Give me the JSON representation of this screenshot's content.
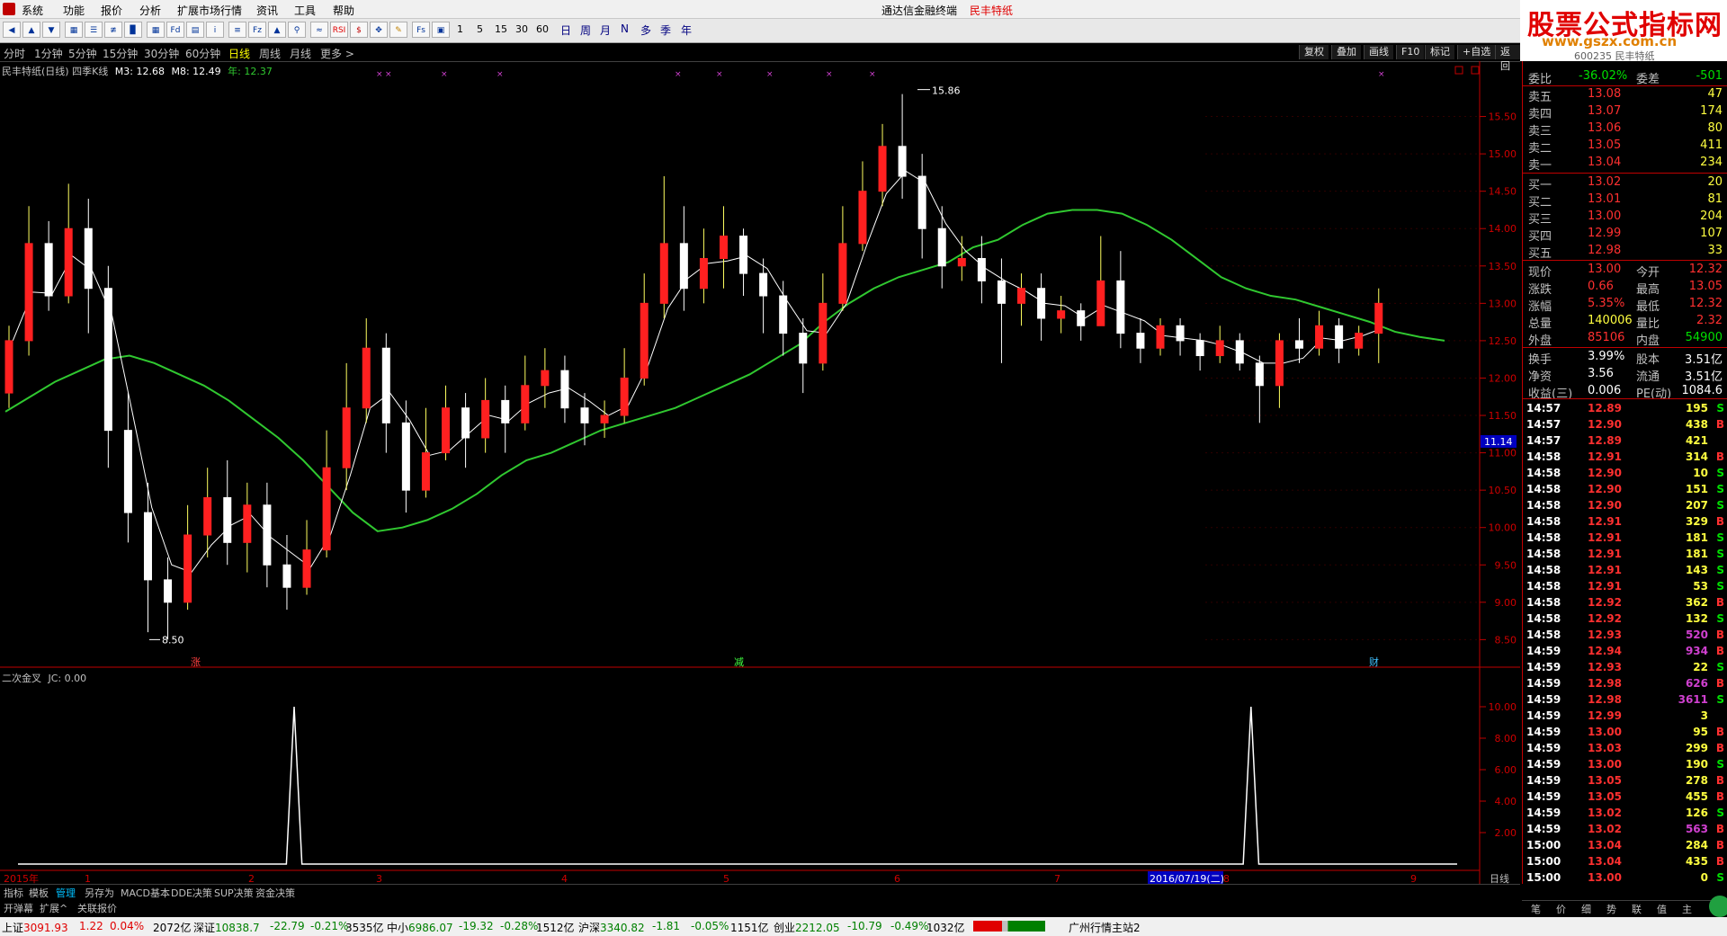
{
  "menu": {
    "items": [
      "系统",
      "功能",
      "报价",
      "分析",
      "扩展市场行情",
      "资讯",
      "工具",
      "帮助"
    ],
    "app_name": "通达信金融终端",
    "stock_title": "民丰特纸"
  },
  "watermark": {
    "line1": "股票公式指标网",
    "line2": "www.gszx.com.cn",
    "sub": "600235 民丰特纸"
  },
  "toolbar": {
    "periods": [
      "1",
      "5",
      "15",
      "30",
      "60"
    ],
    "cn_periods": [
      "日",
      "周",
      "月",
      "N",
      "多",
      "季",
      "年"
    ]
  },
  "periodbar": {
    "items": [
      "分时",
      "1分钟",
      "5分钟",
      "15分钟",
      "30分钟",
      "60分钟",
      "日线",
      "周线",
      "月线",
      "更多 >"
    ],
    "active": "日线",
    "right_buttons": [
      "复权",
      "叠加",
      "画线",
      "F10",
      "标记",
      "+自选",
      "返回"
    ]
  },
  "chart_header": {
    "name": "民丰特纸(日线) 四季K线",
    "m3": "M3: 12.68",
    "m8": "M8: 12.49",
    "year": "年: 12.37"
  },
  "indicator_header": {
    "name": "二次金叉",
    "jc": "JC: 0.00"
  },
  "chart_data": [
    {
      "type": "candlestick",
      "title": "民丰特纸(日线) 四季K线",
      "yticks": [
        "15.50",
        "15.00",
        "14.50",
        "14.00",
        "13.50",
        "13.00",
        "12.50",
        "12.00",
        "11.50",
        "11.00",
        "10.50",
        "10.00",
        "9.50",
        "9.00",
        "8.50"
      ],
      "ylim": [
        8.3,
        16.0
      ],
      "max_label": "15.86",
      "min_label": "8.50",
      "current_price_tag": "11.14",
      "event_markers": [
        "涨",
        "减",
        "财"
      ],
      "xticks": [
        "2015年",
        "1",
        "2",
        "3",
        "4",
        "5",
        "6",
        "7",
        "2016/07/19(二)",
        "8",
        "9"
      ],
      "period_label": "日线",
      "series": [
        {
          "name": "M3",
          "color": "#ffffff"
        },
        {
          "name": "M8",
          "color": "#ffffff"
        },
        {
          "name": "年",
          "color": "#30c830"
        }
      ],
      "ma_year": [
        [
          0,
          11.55
        ],
        [
          10,
          11.75
        ],
        [
          20,
          11.95
        ],
        [
          30,
          12.1
        ],
        [
          40,
          12.25
        ],
        [
          50,
          12.3
        ],
        [
          60,
          12.2
        ],
        [
          70,
          12.05
        ],
        [
          80,
          11.9
        ],
        [
          90,
          11.7
        ],
        [
          100,
          11.45
        ],
        [
          110,
          11.2
        ],
        [
          120,
          10.9
        ],
        [
          130,
          10.55
        ],
        [
          140,
          10.2
        ],
        [
          150,
          9.95
        ],
        [
          160,
          10.0
        ],
        [
          170,
          10.1
        ],
        [
          180,
          10.25
        ],
        [
          190,
          10.45
        ],
        [
          200,
          10.7
        ],
        [
          210,
          10.9
        ],
        [
          220,
          11.0
        ],
        [
          230,
          11.15
        ],
        [
          240,
          11.3
        ],
        [
          250,
          11.4
        ],
        [
          260,
          11.5
        ],
        [
          270,
          11.6
        ],
        [
          280,
          11.75
        ],
        [
          290,
          11.9
        ],
        [
          300,
          12.05
        ],
        [
          310,
          12.25
        ],
        [
          320,
          12.45
        ],
        [
          330,
          12.75
        ],
        [
          340,
          13.0
        ],
        [
          350,
          13.2
        ],
        [
          360,
          13.35
        ],
        [
          370,
          13.45
        ],
        [
          380,
          13.55
        ],
        [
          390,
          13.75
        ],
        [
          400,
          13.85
        ],
        [
          410,
          14.05
        ],
        [
          420,
          14.2
        ],
        [
          430,
          14.25
        ],
        [
          440,
          14.25
        ],
        [
          450,
          14.2
        ],
        [
          460,
          14.05
        ],
        [
          470,
          13.85
        ],
        [
          480,
          13.6
        ],
        [
          490,
          13.35
        ],
        [
          500,
          13.2
        ],
        [
          510,
          13.1
        ],
        [
          520,
          13.05
        ],
        [
          530,
          12.95
        ],
        [
          540,
          12.85
        ],
        [
          550,
          12.75
        ],
        [
          560,
          12.62
        ],
        [
          570,
          12.55
        ],
        [
          580,
          12.5
        ]
      ],
      "candles": [
        [
          0,
          11.8,
          12.5,
          12.7,
          11.6
        ],
        [
          8,
          12.5,
          13.8,
          14.3,
          12.3
        ],
        [
          16,
          13.8,
          13.1,
          14.1,
          12.9
        ],
        [
          24,
          13.1,
          14.0,
          14.6,
          13.0
        ],
        [
          32,
          14.0,
          13.2,
          14.4,
          12.6
        ],
        [
          40,
          13.2,
          11.3,
          13.5,
          10.8
        ],
        [
          48,
          11.3,
          10.2,
          11.8,
          9.8
        ],
        [
          56,
          10.2,
          9.3,
          10.6,
          8.6
        ],
        [
          64,
          9.3,
          9.0,
          9.6,
          8.5
        ],
        [
          72,
          9.0,
          9.9,
          10.3,
          8.9
        ],
        [
          80,
          9.9,
          10.4,
          10.8,
          9.6
        ],
        [
          88,
          10.4,
          9.8,
          10.9,
          9.5
        ],
        [
          96,
          9.8,
          10.3,
          10.6,
          9.4
        ],
        [
          104,
          10.3,
          9.5,
          10.6,
          9.2
        ],
        [
          112,
          9.5,
          9.2,
          9.9,
          8.9
        ],
        [
          120,
          9.2,
          9.7,
          10.1,
          9.1
        ],
        [
          128,
          9.7,
          10.8,
          11.3,
          9.6
        ],
        [
          136,
          10.8,
          11.6,
          12.2,
          10.5
        ],
        [
          144,
          11.6,
          12.4,
          12.8,
          11.4
        ],
        [
          152,
          12.4,
          11.4,
          12.6,
          11.0
        ],
        [
          160,
          11.4,
          10.5,
          11.7,
          10.2
        ],
        [
          168,
          10.5,
          11.0,
          11.6,
          10.4
        ],
        [
          176,
          11.0,
          11.6,
          11.9,
          10.9
        ],
        [
          184,
          11.6,
          11.2,
          11.8,
          10.8
        ],
        [
          192,
          11.2,
          11.7,
          12.0,
          11.0
        ],
        [
          200,
          11.7,
          11.4,
          11.9,
          11.0
        ],
        [
          208,
          11.4,
          11.9,
          12.3,
          11.3
        ],
        [
          216,
          11.9,
          12.1,
          12.4,
          11.6
        ],
        [
          224,
          12.1,
          11.6,
          12.3,
          11.4
        ],
        [
          232,
          11.6,
          11.4,
          11.8,
          11.1
        ],
        [
          240,
          11.4,
          11.5,
          11.7,
          11.2
        ],
        [
          248,
          11.5,
          12.0,
          12.4,
          11.4
        ],
        [
          256,
          12.0,
          13.0,
          13.4,
          11.9
        ],
        [
          264,
          13.0,
          13.8,
          14.7,
          12.8
        ],
        [
          272,
          13.8,
          13.2,
          14.3,
          12.9
        ],
        [
          280,
          13.2,
          13.6,
          14.0,
          13.0
        ],
        [
          288,
          13.6,
          13.9,
          14.3,
          13.2
        ],
        [
          296,
          13.9,
          13.4,
          14.0,
          13.1
        ],
        [
          304,
          13.4,
          13.1,
          13.6,
          12.6
        ],
        [
          312,
          13.1,
          12.6,
          13.3,
          12.3
        ],
        [
          320,
          12.6,
          12.2,
          12.8,
          11.8
        ],
        [
          328,
          12.2,
          13.0,
          13.4,
          12.1
        ],
        [
          336,
          13.0,
          13.8,
          14.3,
          12.9
        ],
        [
          344,
          13.8,
          14.5,
          14.9,
          13.7
        ],
        [
          352,
          14.5,
          15.1,
          15.4,
          14.3
        ],
        [
          360,
          15.1,
          14.7,
          15.8,
          14.4
        ],
        [
          368,
          14.7,
          14.0,
          15.0,
          13.6
        ],
        [
          376,
          14.0,
          13.5,
          14.3,
          13.2
        ],
        [
          384,
          13.5,
          13.6,
          13.9,
          13.3
        ],
        [
          392,
          13.6,
          13.3,
          13.9,
          13.0
        ],
        [
          400,
          13.3,
          13.0,
          13.6,
          12.2
        ],
        [
          408,
          13.0,
          13.2,
          13.4,
          12.7
        ],
        [
          416,
          13.2,
          12.8,
          13.4,
          12.5
        ],
        [
          424,
          12.8,
          12.9,
          13.1,
          12.6
        ],
        [
          432,
          12.9,
          12.7,
          13.0,
          12.5
        ],
        [
          440,
          12.7,
          13.3,
          13.9,
          12.7
        ],
        [
          448,
          13.3,
          12.6,
          13.7,
          12.4
        ],
        [
          456,
          12.6,
          12.4,
          12.8,
          12.2
        ],
        [
          464,
          12.4,
          12.7,
          12.8,
          12.3
        ],
        [
          472,
          12.7,
          12.5,
          12.8,
          12.3
        ],
        [
          480,
          12.5,
          12.3,
          12.6,
          12.1
        ],
        [
          488,
          12.3,
          12.5,
          12.7,
          12.2
        ],
        [
          496,
          12.5,
          12.2,
          12.6,
          12.1
        ],
        [
          504,
          12.2,
          11.9,
          12.3,
          11.4
        ],
        [
          512,
          11.9,
          12.5,
          12.6,
          11.6
        ],
        [
          520,
          12.5,
          12.4,
          12.8,
          12.2
        ],
        [
          528,
          12.4,
          12.7,
          12.9,
          12.3
        ],
        [
          536,
          12.7,
          12.4,
          12.8,
          12.2
        ],
        [
          544,
          12.4,
          12.6,
          12.7,
          12.3
        ],
        [
          552,
          12.6,
          13.0,
          13.2,
          12.2
        ]
      ]
    },
    {
      "type": "line",
      "title": "二次金叉",
      "yticks": [
        "10.00",
        "8.00",
        "6.00",
        "4.00",
        "2.00"
      ],
      "ylim": [
        0,
        11.2
      ],
      "x": [
        0,
        138,
        142,
        146,
        630,
        634,
        638,
        740
      ],
      "values": [
        0,
        0,
        10,
        0,
        0,
        10,
        0,
        0
      ]
    }
  ],
  "quote": {
    "webi": {
      "label": "委比",
      "value": "-36.02%",
      "label2": "委差",
      "value2": "-501"
    },
    "asks": [
      {
        "label": "卖五",
        "price": "13.08",
        "vol": "47"
      },
      {
        "label": "卖四",
        "price": "13.07",
        "vol": "174"
      },
      {
        "label": "卖三",
        "price": "13.06",
        "vol": "80"
      },
      {
        "label": "卖二",
        "price": "13.05",
        "vol": "411"
      },
      {
        "label": "卖一",
        "price": "13.04",
        "vol": "234"
      }
    ],
    "bids": [
      {
        "label": "买一",
        "price": "13.02",
        "vol": "20"
      },
      {
        "label": "买二",
        "price": "13.01",
        "vol": "81"
      },
      {
        "label": "买三",
        "price": "13.00",
        "vol": "204"
      },
      {
        "label": "买四",
        "price": "12.99",
        "vol": "107"
      },
      {
        "label": "买五",
        "price": "12.98",
        "vol": "33"
      }
    ],
    "stats": [
      {
        "l1": "现价",
        "v1": "13.00",
        "l2": "今开",
        "v2": "12.32"
      },
      {
        "l1": "涨跌",
        "v1": "0.66",
        "l2": "最高",
        "v2": "13.05"
      },
      {
        "l1": "涨幅",
        "v1": "5.35%",
        "l2": "最低",
        "v2": "12.32"
      },
      {
        "l1": "总量",
        "v1": "140006",
        "l2": "量比",
        "v2": "2.32"
      },
      {
        "l1": "外盘",
        "v1": "85106",
        "l2": "内盘",
        "v2": "54900"
      }
    ],
    "stats2": [
      {
        "l1": "换手",
        "v1": "3.99%",
        "l2": "股本",
        "v2": "3.51亿"
      },
      {
        "l1": "净资",
        "v1": "3.56",
        "l2": "流通",
        "v2": "3.51亿"
      },
      {
        "l1": "收益(三)",
        "v1": "0.006",
        "l2": "PE(动)",
        "v2": "1084.6"
      }
    ]
  },
  "ticks": [
    {
      "t": "14:57",
      "p": "12.89",
      "v": "195",
      "d": "S"
    },
    {
      "t": "14:57",
      "p": "12.90",
      "v": "438",
      "d": "B"
    },
    {
      "t": "14:57",
      "p": "12.89",
      "v": "421",
      "d": ""
    },
    {
      "t": "14:58",
      "p": "12.91",
      "v": "314",
      "d": "B"
    },
    {
      "t": "14:58",
      "p": "12.90",
      "v": "10",
      "d": "S"
    },
    {
      "t": "14:58",
      "p": "12.90",
      "v": "151",
      "d": "S"
    },
    {
      "t": "14:58",
      "p": "12.90",
      "v": "207",
      "d": "S"
    },
    {
      "t": "14:58",
      "p": "12.91",
      "v": "329",
      "d": "B"
    },
    {
      "t": "14:58",
      "p": "12.91",
      "v": "181",
      "d": "S"
    },
    {
      "t": "14:58",
      "p": "12.91",
      "v": "181",
      "d": "S"
    },
    {
      "t": "14:58",
      "p": "12.91",
      "v": "143",
      "d": "S"
    },
    {
      "t": "14:58",
      "p": "12.91",
      "v": "53",
      "d": "S"
    },
    {
      "t": "14:58",
      "p": "12.92",
      "v": "362",
      "d": "B"
    },
    {
      "t": "14:58",
      "p": "12.92",
      "v": "132",
      "d": "S"
    },
    {
      "t": "14:58",
      "p": "12.93",
      "v": "520",
      "d": "B"
    },
    {
      "t": "14:59",
      "p": "12.94",
      "v": "934",
      "d": "B"
    },
    {
      "t": "14:59",
      "p": "12.93",
      "v": "22",
      "d": "S"
    },
    {
      "t": "14:59",
      "p": "12.98",
      "v": "626",
      "d": "B"
    },
    {
      "t": "14:59",
      "p": "12.98",
      "v": "3611",
      "d": "S"
    },
    {
      "t": "14:59",
      "p": "12.99",
      "v": "3",
      "d": ""
    },
    {
      "t": "14:59",
      "p": "13.00",
      "v": "95",
      "d": "B"
    },
    {
      "t": "14:59",
      "p": "13.03",
      "v": "299",
      "d": "B"
    },
    {
      "t": "14:59",
      "p": "13.00",
      "v": "190",
      "d": "S"
    },
    {
      "t": "14:59",
      "p": "13.05",
      "v": "278",
      "d": "B"
    },
    {
      "t": "14:59",
      "p": "13.05",
      "v": "455",
      "d": "B"
    },
    {
      "t": "14:59",
      "p": "13.02",
      "v": "126",
      "d": "S"
    },
    {
      "t": "14:59",
      "p": "13.02",
      "v": "563",
      "d": "B"
    },
    {
      "t": "15:00",
      "p": "13.04",
      "v": "284",
      "d": "B"
    },
    {
      "t": "15:00",
      "p": "13.04",
      "v": "435",
      "d": "B"
    },
    {
      "t": "15:00",
      "p": "13.00",
      "v": "0",
      "d": "S"
    }
  ],
  "bottom_tabs1": [
    "指标",
    "模板",
    "管理",
    "另存为",
    "MACD基本",
    "DDE决策",
    "SUP决策",
    "资金决策"
  ],
  "bottom_tabs2": [
    "开弹幕",
    "扩展^",
    "关联报价"
  ],
  "right_tabs": [
    "笔",
    "价",
    "细",
    "势",
    "联",
    "值",
    "主"
  ],
  "statusbar": {
    "sh_label": "上证",
    "sh_val": "3091.93",
    "sh_chg": "1.22",
    "sh_pct": "0.04%",
    "sh_amt": "2072亿",
    "sz_label": "深证",
    "sz_val": "10838.7",
    "sz_chg": "-22.79",
    "sz_pct": "-0.21%",
    "sz_amt": "3535亿",
    "zx_label": "中小",
    "zx_val": "6986.07",
    "zx_chg": "-19.32",
    "zx_pct": "-0.28%",
    "zx_amt": "1512亿",
    "hs_label": "沪深",
    "hs_val": "3340.82",
    "hs_chg": "-1.81",
    "hs_pct": "-0.05%",
    "hs_amt": "1151亿",
    "cy_label": "创业",
    "cy_val": "2212.05",
    "cy_chg": "-10.79",
    "cy_pct": "-0.49%",
    "cy_amt": "1032亿",
    "server": "广州行情主站2"
  }
}
